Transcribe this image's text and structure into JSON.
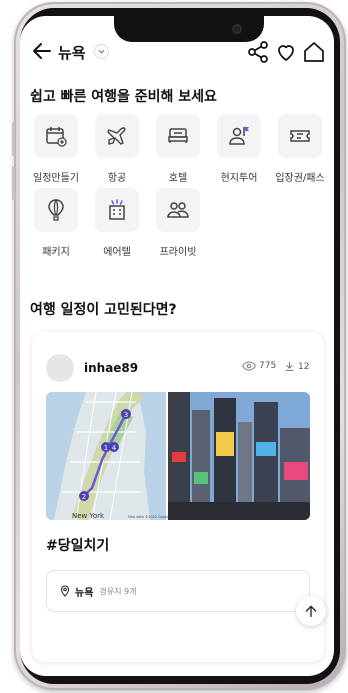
{
  "header": {
    "city": "뉴욕"
  },
  "planner": {
    "title": "쉽고 빠른 여행을 준비해 보세요",
    "categories": [
      {
        "label": "일정만들기",
        "icon": "calendar-plus-icon"
      },
      {
        "label": "항공",
        "icon": "airplane-icon"
      },
      {
        "label": "호텔",
        "icon": "bed-icon"
      },
      {
        "label": "현지투어",
        "icon": "tour-guide-icon"
      },
      {
        "label": "입장권/패스",
        "icon": "ticket-icon"
      },
      {
        "label": "패키지",
        "icon": "hot-air-balloon-icon"
      },
      {
        "label": "에어텔",
        "icon": "airtel-building-icon"
      },
      {
        "label": "프라이빗",
        "icon": "private-people-icon"
      }
    ]
  },
  "feed": {
    "title": "여행 일정이 고민된다면?",
    "post": {
      "username": "inhae89",
      "views": "775",
      "downloads": "12",
      "map_attribution": "Map data ©2022 Google",
      "map_city_label": "New York",
      "map_markers": [
        "1",
        "2",
        "3",
        "4"
      ],
      "hashtag": "#당일치기",
      "route_city": "뉴욕",
      "route_stops": "경유지 9개"
    }
  },
  "colors": {
    "accent": "#6b5bd6",
    "icon_bg": "#f3f4f6"
  }
}
